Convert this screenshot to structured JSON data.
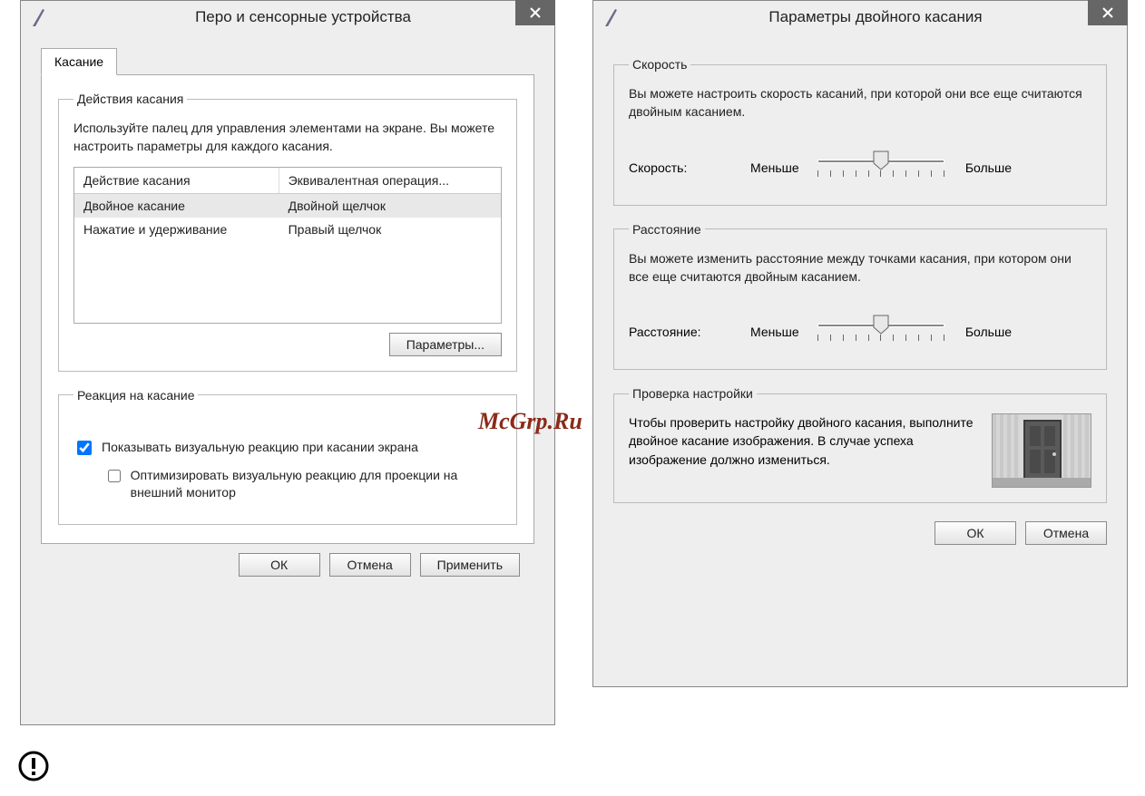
{
  "watermark": "McGrp.Ru",
  "dialog1": {
    "title": "Перо и сенсорные устройства",
    "tab_label": "Касание",
    "actions_group": {
      "legend": "Действия касания",
      "desc": "Используйте палец для управления элементами на экране. Вы можете настроить параметры для каждого касания.",
      "columns": {
        "c1": "Действие касания",
        "c2": "Эквивалентная операция..."
      },
      "rows": [
        {
          "action": "Двойное касание",
          "equiv": "Двойной щелчок",
          "selected": true
        },
        {
          "action": "Нажатие и удерживание",
          "equiv": "Правый щелчок",
          "selected": false
        }
      ],
      "settings_btn": "Параметры..."
    },
    "feedback_group": {
      "legend": "Реакция на касание",
      "cb1_label": "Показывать визуальную реакцию при касании экрана",
      "cb1_checked": true,
      "cb2_label": "Оптимизировать визуальную реакцию для проекции на внешний монитор",
      "cb2_checked": false
    },
    "buttons": {
      "ok": "ОК",
      "cancel": "Отмена",
      "apply": "Применить"
    }
  },
  "dialog2": {
    "title": "Параметры двойного касания",
    "speed_group": {
      "legend": "Скорость",
      "desc": "Вы можете настроить скорость касаний, при которой они все еще считаются двойным касанием.",
      "label": "Скорость:",
      "less": "Меньше",
      "more": "Больше",
      "value_percent": 50
    },
    "distance_group": {
      "legend": "Расстояние",
      "desc": "Вы можете изменить расстояние между точками касания, при котором они все еще считаются двойным касанием.",
      "label": "Расстояние:",
      "less": "Меньше",
      "more": "Больше",
      "value_percent": 50
    },
    "test_group": {
      "legend": "Проверка настройки",
      "desc": "Чтобы проверить настройку двойного касания, выполните двойное касание изображения. В случае успеха изображение должно измениться."
    },
    "buttons": {
      "ok": "ОК",
      "cancel": "Отмена"
    }
  }
}
